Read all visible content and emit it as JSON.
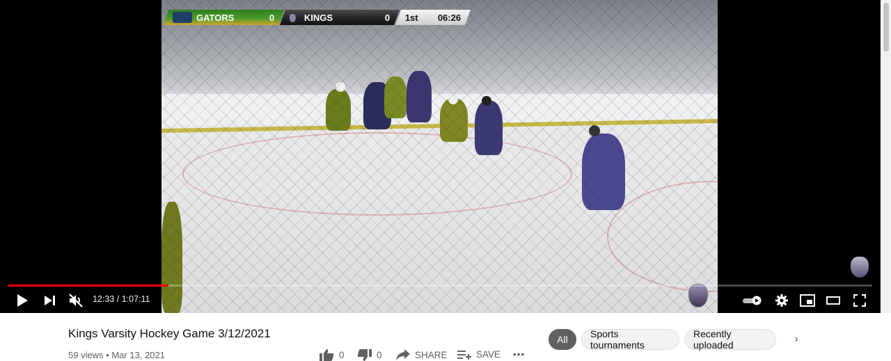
{
  "scoreboard": {
    "home_team": "GATORS",
    "home_score": "0",
    "away_team": "KINGS",
    "away_score": "0",
    "period": "1st",
    "clock": "06:26",
    "home_logo_text": "GATORS"
  },
  "watermark": {
    "text": "KINGS"
  },
  "player": {
    "time_display": "12:33 / 1:07:11",
    "progress_fraction": 0.185,
    "progress_color": "#ff0000",
    "controls": {
      "play": "play-icon",
      "next": "next-icon",
      "mute": "volume-muted-icon",
      "autoplay": "autoplay-toggle-icon",
      "settings": "gear-icon",
      "miniplayer": "miniplayer-icon",
      "theater": "theater-mode-icon",
      "fullscreen": "fullscreen-icon"
    }
  },
  "video_info": {
    "title": "Kings Varsity Hockey Game 3/12/2021",
    "views_date": "59 views • Mar 13, 2021"
  },
  "actions": {
    "like_count": "0",
    "dislike_count": "0",
    "share_label": "SHARE",
    "save_label": "SAVE",
    "more_label": "•••"
  },
  "chips": {
    "items": [
      {
        "label": "All",
        "active": true
      },
      {
        "label": "Sports tournaments",
        "active": false
      },
      {
        "label": "Recently uploaded",
        "active": false
      }
    ],
    "next_label": "›"
  }
}
